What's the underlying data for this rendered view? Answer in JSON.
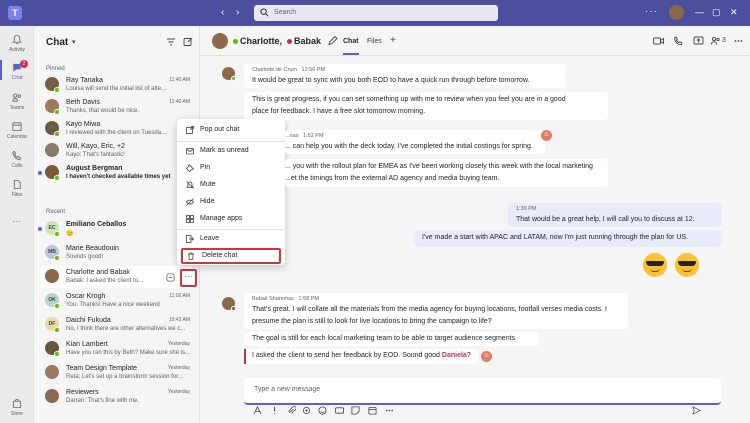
{
  "titlebar": {
    "app_logo": "T",
    "back_icon": "‹",
    "forward_icon": "›",
    "search_placeholder": "Search",
    "more": "···",
    "min": "—",
    "max": "▢",
    "close": "✕"
  },
  "rail": {
    "items": [
      {
        "label": "Activity",
        "icon": "bell-icon"
      },
      {
        "label": "Chat",
        "icon": "chat-icon",
        "badge": "2"
      },
      {
        "label": "Teams",
        "icon": "teams-icon"
      },
      {
        "label": "Calendar",
        "icon": "calendar-icon"
      },
      {
        "label": "Calls",
        "icon": "phone-icon"
      },
      {
        "label": "Files",
        "icon": "file-icon"
      }
    ],
    "more": "···",
    "store": "Store"
  },
  "chatlist": {
    "title": "Chat",
    "sections": {
      "pinned": "Pinned",
      "recent": "Recent"
    },
    "rows": [
      {
        "name": "Ray Tanaka",
        "preview": "Louisa will send the initial list of atte...",
        "time": "11:40 AM",
        "initials": "",
        "color": "#7a5c44",
        "presence": "#6bb700"
      },
      {
        "name": "Beth Davis",
        "preview": "Thanks, that would be nice.",
        "time": "11:40 AM",
        "initials": "",
        "color": "#a0785a",
        "presence": "#6bb700"
      },
      {
        "name": "Kayo Miwa",
        "preview": "I reviewed with the client on Tuesda...",
        "time": "",
        "initials": "",
        "color": "#6e5a48",
        "presence": "#6bb700"
      },
      {
        "name": "Will, Kayo, Eric, +2",
        "preview": "Kayo: That's fantastic!",
        "time": "",
        "initials": "",
        "color": "#8a7a6a",
        "presence": ""
      },
      {
        "name": "August Bergman",
        "preview": "I haven't checked available times yet",
        "time": "",
        "initials": "",
        "color": "#7a5a3a",
        "presence": "#6bb700"
      },
      {
        "name": "Emiliano Ceballos",
        "preview": "😊",
        "time": "",
        "initials": "EC",
        "color": "#cfe3b8",
        "presence": "#6bb700"
      },
      {
        "name": "Marie Beaudouin",
        "preview": "Sounds good!",
        "time": "",
        "initials": "MB",
        "color": "#b9c7de",
        "presence": "#6bb700"
      },
      {
        "name": "Charlotte and Babak",
        "preview": "Babak: I asked the client to...",
        "time": "",
        "initials": "",
        "color": "#8a6a4a",
        "presence": ""
      },
      {
        "name": "Oscar Krogh",
        "preview": "You: Thanks! Have a nice weekend",
        "time": "11:02 AM",
        "initials": "OK",
        "color": "#b7d7c7",
        "presence": "#6bb700"
      },
      {
        "name": "Daichi Fukuda",
        "preview": "No, I think there are other alternatives we c...",
        "time": "10:43 AM",
        "initials": "DF",
        "color": "#eadba0",
        "presence": "#6bb700"
      },
      {
        "name": "Kian Lambert",
        "preview": "Have you ran this by Beth? Make sure she is...",
        "time": "Yesterday",
        "initials": "",
        "color": "#6a543e",
        "presence": "#6bb700"
      },
      {
        "name": "Team Design Template",
        "preview": "Reta: Let's set up a brainstorm session for...",
        "time": "Yesterday",
        "initials": "",
        "color": "#9b7a62",
        "presence": ""
      },
      {
        "name": "Reviewers",
        "preview": "Darren: That's fine with me.",
        "time": "Yesterday",
        "initials": "",
        "color": "#8a6a55",
        "presence": ""
      }
    ],
    "more_button": "···"
  },
  "context_menu": {
    "items": [
      "Pop out chat",
      "Mark as unread",
      "Pin",
      "Mute",
      "Hide",
      "Manage apps",
      "Leave",
      "Delete chat"
    ],
    "icons": [
      "pop-out-icon",
      "mark-unread-icon",
      "pin-icon",
      "mute-icon",
      "hide-icon",
      "manage-apps-icon",
      "leave-icon",
      "delete-icon"
    ]
  },
  "header": {
    "name1": "Charlotte,",
    "name2": "Babak",
    "tab_chat": "Chat",
    "tab_files": "Files",
    "add_tab": "+",
    "participants": "3"
  },
  "messages": {
    "m1_author": "Charlotte de Crum",
    "m1_time": "12:56 PM",
    "m1_text": "It would be great to sync with you both EOD to have a quick run through before tomorrow.",
    "m2_l1": "This is great progress, if you can set something up with me to review when you feel you are in a good",
    "m2_l2": "place for feedback. I have a free slot tomorrow morning.",
    "m3_author": "...nas",
    "m3_time": "1:52 PM",
    "m3_text": "... can help you with the deck today. I've completed the initial costings for spring.",
    "m4_l1": "... you with the rollout plan for EMEA as I've been working closely this week with the local marketing",
    "m4_l2": "...et the timings from the external AD agency and media buying team.",
    "m5_time": "1:30 PM",
    "m5_text": "That would be a great help, I will call you to discuss at 12.",
    "m6_text": "I've made a start with APAC and LATAM, now I'm just running through the plan for US.",
    "m7_author": "Babak Shammas",
    "m7_time": "1:58 PM",
    "m7_l1": "That's great. I will collate all the materials from the media agency for buying locations, footfall verses media costs. I",
    "m7_l2": "presume the plan is still to look for live locations to bring the campaign to life?",
    "m8_text": "The goal is still for each local marketing team to be able to target audience segments",
    "m9_text": "I asked the client to send her feedback by EOD. Sound good",
    "m9_mention": "Daniela",
    "m9_end": "?",
    "reaction": "☺"
  },
  "compose": {
    "placeholder": "Type a new message",
    "send_icon": "send-icon"
  },
  "colors": {
    "titlebar": "#4b4f9e",
    "accent": "#5b5fc7",
    "highlight": "#d13438",
    "available": "#6bb700",
    "busy": "#c4314b"
  }
}
